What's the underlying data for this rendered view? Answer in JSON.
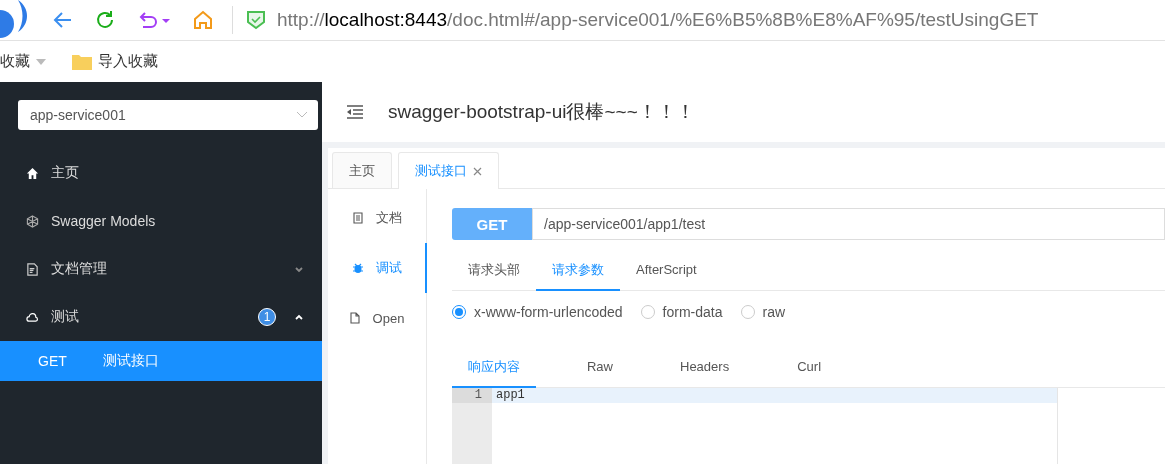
{
  "browser": {
    "address_bar": {
      "scheme": "http://",
      "host": "localhost:8443",
      "path": "/doc.html#/app-service001/%E6%B5%8B%E8%AF%95/testUsingGET"
    },
    "bookmarks": [
      {
        "label": "收藏",
        "kind": "menu"
      },
      {
        "label": "导入收藏",
        "kind": "folder"
      }
    ]
  },
  "sidebar": {
    "service_select": {
      "value": "app-service001"
    },
    "items": [
      {
        "label": "主页"
      },
      {
        "label": "Swagger Models"
      },
      {
        "label": "文档管理",
        "expanded": false
      },
      {
        "label": "测试",
        "badge": "1",
        "expanded": true,
        "children": [
          {
            "method": "GET",
            "label": "测试接口",
            "selected": true
          }
        ]
      }
    ]
  },
  "header": {
    "title": "swagger-bootstrap-ui很棒~~~！！！"
  },
  "tabs": [
    {
      "label": "主页",
      "selected": false,
      "closable": false
    },
    {
      "label": "测试接口",
      "selected": true,
      "closable": true
    }
  ],
  "side_tabs": [
    {
      "label": "文档",
      "selected": false
    },
    {
      "label": "调试",
      "selected": true
    },
    {
      "label": "Open",
      "selected": false
    }
  ],
  "request": {
    "method": "GET",
    "path": "/app-service001/app1/test"
  },
  "request_tabs": [
    {
      "label": "请求头部",
      "selected": false
    },
    {
      "label": "请求参数",
      "selected": true
    },
    {
      "label": "AfterScript",
      "selected": false
    }
  ],
  "body_types": [
    {
      "label": "x-www-form-urlencoded",
      "selected": true
    },
    {
      "label": "form-data",
      "selected": false
    },
    {
      "label": "raw",
      "selected": false
    }
  ],
  "response_tabs": [
    {
      "label": "响应内容",
      "selected": true
    },
    {
      "label": "Raw",
      "selected": false
    },
    {
      "label": "Headers",
      "selected": false
    },
    {
      "label": "Curl",
      "selected": false
    }
  ],
  "editor": {
    "lines": [
      {
        "number": "1",
        "text": "app1"
      }
    ]
  }
}
